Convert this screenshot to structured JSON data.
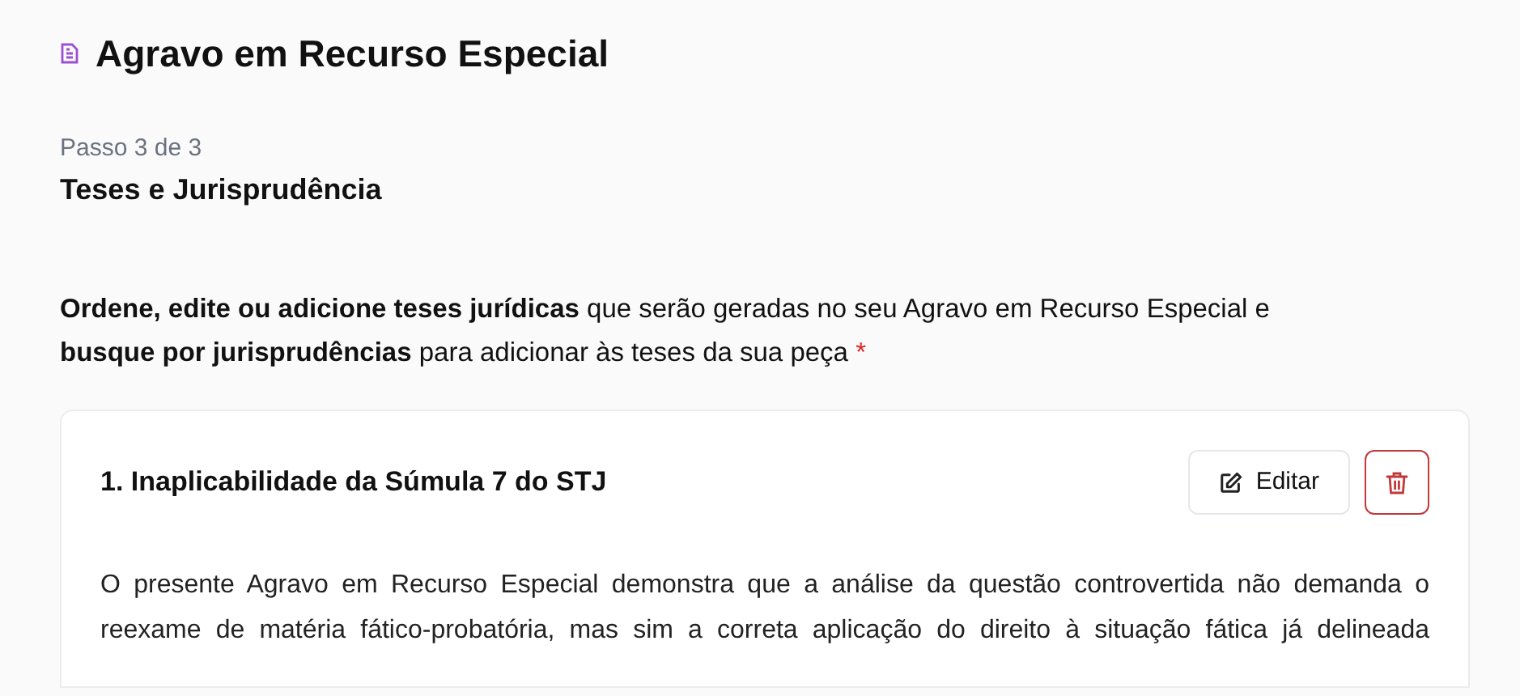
{
  "header": {
    "title": "Agravo em Recurso Especial"
  },
  "step": {
    "counter": "Passo 3 de 3",
    "title": "Teses e Jurisprudência"
  },
  "instructions": {
    "text": "**Ordene, edite ou adicione teses jurídicas** que serão geradas no seu Agravo em Recurso Especial e **busque por jurisprudências** para adicionar às teses da sua peça",
    "required_mark": "*"
  },
  "theses": [
    {
      "title": "1. Inaplicabilidade da Súmula 7 do STJ",
      "edit_label": "Editar",
      "body_lines": [
        "O presente Agravo em Recurso Especial demonstra que a análise da questão controvertida não demanda o",
        "reexame de matéria fático-probatória, mas sim a correta aplicação do direito à situação fática já delineada"
      ]
    }
  ]
}
